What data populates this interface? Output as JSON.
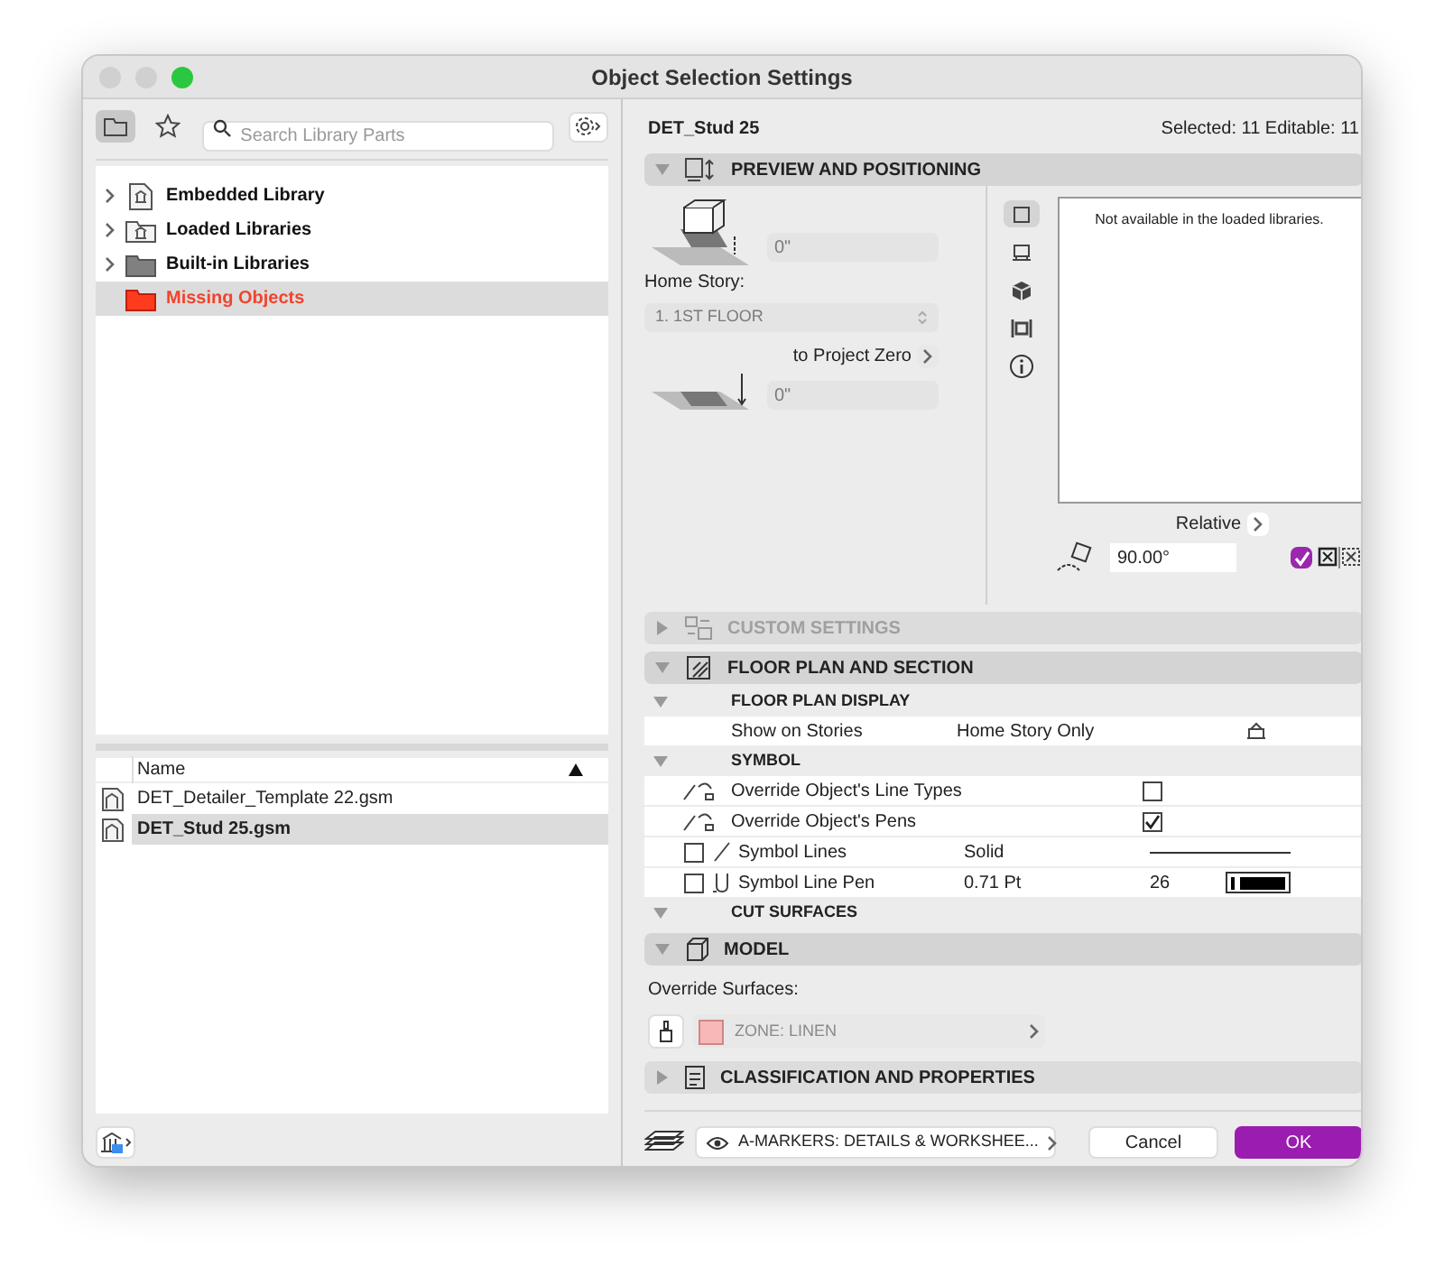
{
  "window": {
    "title": "Object Selection Settings"
  },
  "library": {
    "tabs": [
      {
        "kind": "folder",
        "selected": true
      },
      {
        "kind": "star",
        "selected": false
      }
    ],
    "search": {
      "placeholder": "Search Library Parts"
    },
    "tree": [
      {
        "label": "Embedded Library",
        "kind": "embedded",
        "selected": false
      },
      {
        "label": "Loaded Libraries",
        "kind": "loaded",
        "selected": false
      },
      {
        "label": "Built-in Libraries",
        "kind": "builtin",
        "selected": false
      },
      {
        "label": "Missing Objects",
        "kind": "missing",
        "selected": true
      }
    ]
  },
  "files": {
    "column": "Name",
    "rows": [
      {
        "name": "DET_Detailer_Template 22.gsm",
        "selected": false
      },
      {
        "name": "DET_Stud 25.gsm",
        "selected": true
      }
    ]
  },
  "object": {
    "name": "DET_Stud 25",
    "info": "Selected: 11 Editable: 11"
  },
  "preview": {
    "title": "PREVIEW AND POSITIONING",
    "expanded": true,
    "elevation": "0\"",
    "home_story_label": "Home Story:",
    "home_story": "1. 1ST FLOOR",
    "zero_label": "to Project Zero",
    "zero_value": "0\"",
    "message": "Not available in the loaded libraries.",
    "views": [
      {
        "kind": "plan",
        "selected": true
      },
      {
        "kind": "section",
        "selected": false
      },
      {
        "kind": "cube",
        "selected": false
      },
      {
        "kind": "elevation",
        "selected": false
      },
      {
        "kind": "info",
        "selected": false
      }
    ],
    "relative_label": "Relative",
    "angle": "90.00°",
    "mirror_checked": true
  },
  "custom_settings": {
    "title": "CUSTOM SETTINGS",
    "expanded": false,
    "disabled": true
  },
  "floor_plan": {
    "title": "FLOOR PLAN AND SECTION",
    "expanded": true,
    "groups": [
      {
        "title": "FLOOR PLAN DISPLAY",
        "expanded": true,
        "rows": [
          {
            "kind": "story",
            "label": "Show on Stories",
            "value": "Home Story Only"
          }
        ]
      },
      {
        "title": "SYMBOL",
        "expanded": true,
        "rows": [
          {
            "kind": "override",
            "label": "Override Object's Line Types",
            "checked": false
          },
          {
            "kind": "override",
            "label": "Override Object's Pens",
            "checked": true
          },
          {
            "kind": "line",
            "label": "Symbol Lines",
            "value": "Solid",
            "checked": false
          },
          {
            "kind": "pen",
            "label": "Symbol Line Pen",
            "value": "0.71 Pt",
            "number": "26",
            "checked": false
          }
        ]
      },
      {
        "title": "CUT SURFACES",
        "expanded": true
      }
    ]
  },
  "model": {
    "title": "MODEL",
    "expanded": true,
    "override_label": "Override Surfaces:",
    "surface": {
      "label": "ZONE: LINEN",
      "color": "#f9b8b8"
    }
  },
  "classification": {
    "title": "CLASSIFICATION AND PROPERTIES",
    "expanded": false
  },
  "footer": {
    "layer": "A-MARKERS: DETAILS & WORKSHEE...",
    "cancel": "Cancel",
    "ok": "OK"
  }
}
